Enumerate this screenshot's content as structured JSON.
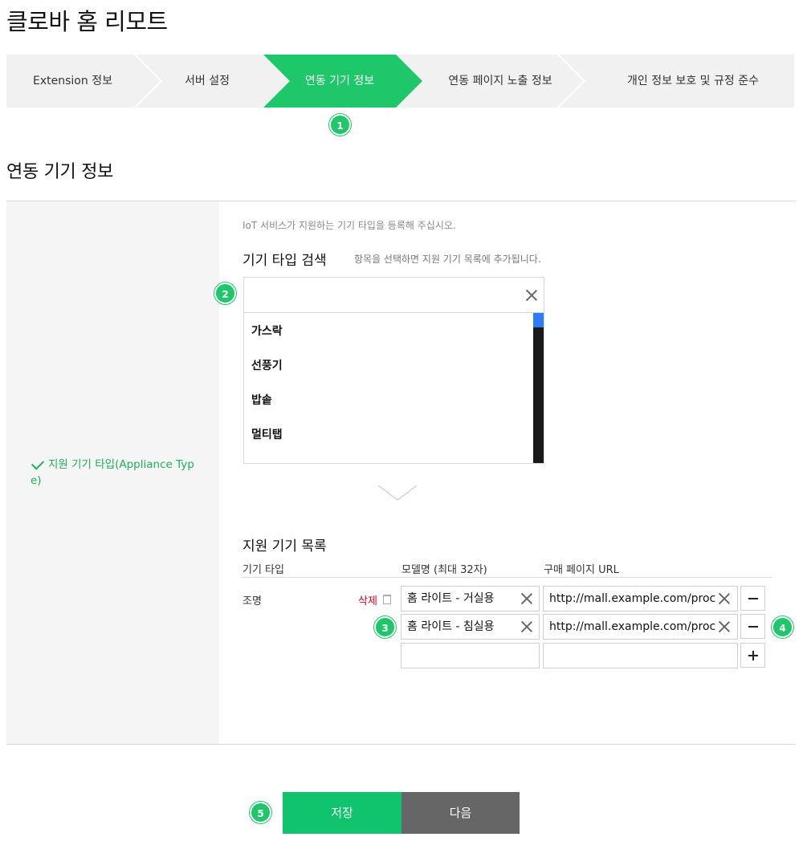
{
  "page": {
    "title": "클로바 홈 리모트"
  },
  "steps": [
    {
      "label": "Extension 정보",
      "active": false
    },
    {
      "label": "서버 설정",
      "active": false
    },
    {
      "label": "연동 기기 정보",
      "active": true
    },
    {
      "label": "연동 페이지 노출 정보",
      "active": false
    },
    {
      "label": "개인 정보 보호 및 규정 준수",
      "active": false
    }
  ],
  "badges": [
    "1",
    "2",
    "3",
    "4",
    "5"
  ],
  "section": {
    "title": "연동 기기 정보"
  },
  "field": {
    "label": "지원 기기 타입(Appliance Type)"
  },
  "form": {
    "description": "IoT 서비스가 지원하는 기기 타입을 등록해 주십시오.",
    "search_title": "기기 타입 검색",
    "search_hint": "항목을 선택하면 지원 기기 목록에 추가됩니다.",
    "search_value": "",
    "dropdown_items": [
      "가스락",
      "선풍기",
      "밥솥",
      "멀티탭"
    ]
  },
  "list": {
    "title": "지원 기기 목록",
    "col_type": "기기 타입",
    "col_model": "모델명 (최대 32자)",
    "col_url": "구매 페이지 URL",
    "type_name": "조명",
    "delete_label": "삭제",
    "rows": [
      {
        "model": "홈 라이트 - 거실용",
        "url": "http://mall.example.com/proc"
      },
      {
        "model": "홈 라이트 - 침실용",
        "url": "http://mall.example.com/proc"
      },
      {
        "model": "",
        "url": ""
      }
    ]
  },
  "buttons": {
    "save": "저장",
    "next": "다음"
  },
  "colors": {
    "accent": "#1ec76a",
    "next_button": "#666666",
    "delete": "#d0021b"
  }
}
